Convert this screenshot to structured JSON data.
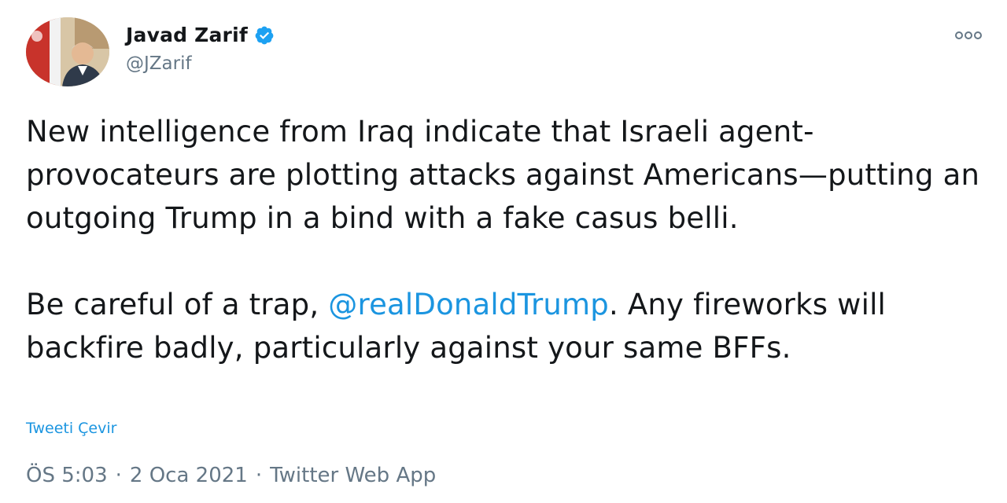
{
  "tweet": {
    "author": {
      "display_name": "Javad Zarif",
      "handle": "@JZarif",
      "verified_icon": "verified-badge-icon",
      "avatar": "avatar"
    },
    "more_icon": "more-options-icon",
    "text": {
      "paragraph1": "New intelligence from Iraq indicate that Israeli agent-provocateurs are plotting attacks against Americans—putting an outgoing Trump in a bind with a fake casus belli.",
      "paragraph2_before": "Be careful of a trap, ",
      "mention": "@realDonaldTrump",
      "paragraph2_after": ". Any fireworks will backfire badly, particularly against your same BFFs."
    },
    "translate_label": "Tweeti Çevir",
    "time": "ÖS 5:03",
    "separator": "·",
    "date": "2 Oca 2021",
    "source": "Twitter Web App"
  },
  "colors": {
    "link": "#1b95e0",
    "text": "#14171a",
    "muted": "#657786",
    "verified": "#1da1f2"
  }
}
